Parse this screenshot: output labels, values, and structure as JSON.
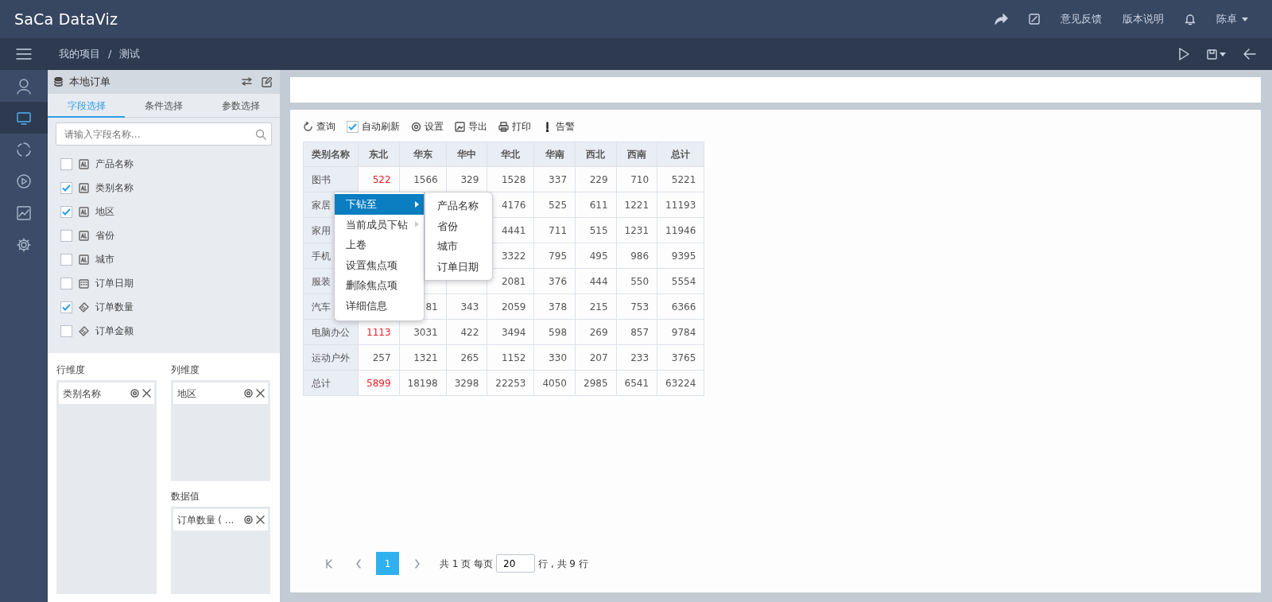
{
  "header": {
    "logo": "SaCa DataViz",
    "links": [
      "意见反馈",
      "版本说明"
    ],
    "user": "陈卓"
  },
  "breadcrumb": {
    "items": [
      "我的项目",
      "测试"
    ],
    "separator": "/"
  },
  "rail": [
    {
      "selected": false
    },
    {
      "selected": true
    },
    {
      "selected": false
    },
    {
      "selected": false
    },
    {
      "selected": false
    },
    {
      "selected": false
    }
  ],
  "dataset": {
    "title": "本地订单"
  },
  "panel_tabs": [
    {
      "label": "字段选择",
      "selected": true
    },
    {
      "label": "条件选择",
      "selected": false
    },
    {
      "label": "参数选择",
      "selected": false
    }
  ],
  "search": {
    "placeholder": "请输入字段名称..."
  },
  "fields": [
    {
      "kind": "text",
      "label": "产品名称",
      "checked": false
    },
    {
      "kind": "text",
      "label": "类别名称",
      "checked": true
    },
    {
      "kind": "text",
      "label": "地区",
      "checked": true
    },
    {
      "kind": "text",
      "label": "省份",
      "checked": false
    },
    {
      "kind": "text",
      "label": "城市",
      "checked": false
    },
    {
      "kind": "date",
      "label": "订单日期",
      "checked": false
    },
    {
      "kind": "measure",
      "label": "订单数量",
      "checked": true
    },
    {
      "kind": "measure",
      "label": "订单金额",
      "checked": false
    }
  ],
  "zones": [
    {
      "title": "行维度",
      "items": [
        "类别名称"
      ]
    },
    {
      "title": "列维度",
      "items": [
        "地区"
      ]
    },
    {
      "title": "数据值",
      "items": [
        "订单数量 ( ..."
      ]
    }
  ],
  "toolbar": [
    {
      "kind": "refresh",
      "label": "查询"
    },
    {
      "kind": "checkbox",
      "label": "自动刷新",
      "checked": true
    },
    {
      "kind": "gear",
      "label": "设置"
    },
    {
      "kind": "export",
      "label": "导出"
    },
    {
      "kind": "print",
      "label": "打印"
    },
    {
      "kind": "alert",
      "label": "告警"
    }
  ],
  "table": {
    "columns": [
      "类别名称",
      "东北",
      "华东",
      "华中",
      "华北",
      "华南",
      "西北",
      "西南",
      "总计"
    ],
    "rows": [
      [
        "图书",
        {
          "text": "522",
          "focus": true
        },
        "1566",
        "329",
        "1528",
        "337",
        "229",
        "710",
        "5221"
      ],
      [
        "家居",
        null,
        null,
        null,
        "4176",
        "525",
        "611",
        "1221",
        "11193"
      ],
      [
        "家用",
        null,
        null,
        null,
        "4441",
        "711",
        "515",
        "1231",
        "11946"
      ],
      [
        "手机",
        null,
        null,
        null,
        "3322",
        "795",
        "495",
        "986",
        "9395"
      ],
      [
        "服装",
        null,
        null,
        null,
        "2081",
        "376",
        "444",
        "550",
        "5554"
      ],
      [
        "汽车",
        null,
        "81",
        "343",
        "2059",
        "378",
        "215",
        "753",
        "6366"
      ],
      [
        "电脑办公",
        {
          "text": "1113",
          "focus": true
        },
        "3031",
        "422",
        "3494",
        "598",
        "269",
        "857",
        "9784"
      ],
      [
        "运动户外",
        "257",
        "1321",
        "265",
        "1152",
        "330",
        "207",
        "233",
        "3765"
      ],
      [
        "总计",
        {
          "text": "5899",
          "focus": true
        },
        "18198",
        "3298",
        "22253",
        "4050",
        "2985",
        "6541",
        "63224"
      ]
    ]
  },
  "context_menu": {
    "items": [
      {
        "label": "下钻至",
        "selected": true,
        "submenu": true
      },
      {
        "label": "当前成员下钻",
        "selected": false,
        "submenu": true
      },
      {
        "label": "上卷",
        "selected": false,
        "submenu": false
      },
      {
        "label": "设置焦点项",
        "selected": false,
        "submenu": false
      },
      {
        "label": "删除焦点项",
        "selected": false,
        "submenu": false
      },
      {
        "label": "详细信息",
        "selected": false,
        "submenu": false
      }
    ],
    "submenu": [
      "产品名称",
      "省份",
      "城市",
      "订单日期"
    ]
  },
  "pagination": {
    "current": "1",
    "summary": "共 1 页 每页",
    "page_size": "20",
    "rows_text": "行 , 共 9 行"
  }
}
